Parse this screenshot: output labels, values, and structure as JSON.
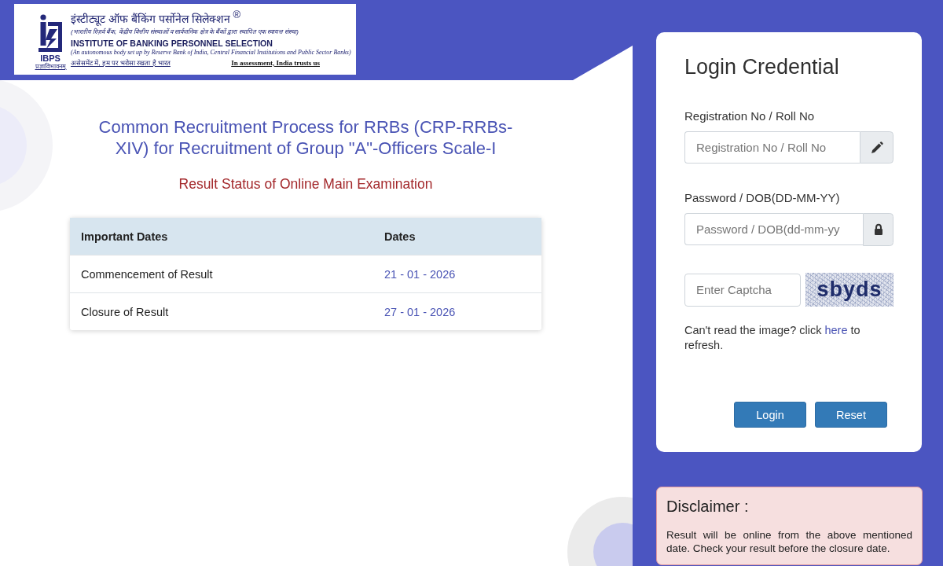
{
  "header": {
    "logo": {
      "emblem_text": "IBPS",
      "emblem_motto": "प्रज्ञाविभावनम्",
      "hindi_name": "इंस्टीट्यूट ऑफ बैंकिंग पर्सोनेल सिलेक्शन $^{®}$",
      "hindi_subtitle": "(भारतीय रिज़र्व बैंक, केंद्रीय वित्तीय संस्थाओं व सार्वजनिक क्षेत्र के बैंकों द्वारा स्थापित एक स्वायत्त संस्था)",
      "name": "INSTITUTE OF BANKING PERSONNEL SELECTION",
      "subtitle": "(An autonomous body set up by Reserve Bank of India, Central Financial Institutions and Public Sector Banks)",
      "hindi_tagline": "असेसमेंट में, हम पर भरोसा रखता है भारत",
      "tagline": "In assessment, India trusts us"
    }
  },
  "main": {
    "title": "Common Recruitment Process for RRBs (CRP-RRBs-XIV) for Recruitment of Group \"A\"-Officers Scale-I",
    "subtitle": "Result Status of Online Main Examination",
    "table": {
      "columns": [
        "Important Dates",
        "Dates"
      ],
      "rows": [
        [
          "Commencement of Result",
          "21 - 01 - 2026"
        ],
        [
          "Closure of Result",
          "27 - 01 - 2026"
        ]
      ]
    }
  },
  "login": {
    "title": "Login Credential",
    "fields": [
      {
        "kind": "text",
        "label": "Registration No / Roll No",
        "placeholder": "Registration No / Roll No"
      },
      {
        "kind": "password",
        "label": "Password / DOB(DD-MM-YY)",
        "placeholder": "Password / DOB(dd-mm-yy"
      }
    ],
    "captcha": {
      "placeholder": "Enter Captcha",
      "image_text": "sbyds"
    },
    "refresh_note": {
      "text_before": "Can't read the image? click",
      "link": "here",
      "text_after": "to refresh."
    },
    "buttons": [
      "Login",
      "Reset"
    ]
  },
  "disclaimer": {
    "title": "Disclaimer :",
    "text": "Result will be online from the above mentioned date. Check your result before the closure date."
  }
}
